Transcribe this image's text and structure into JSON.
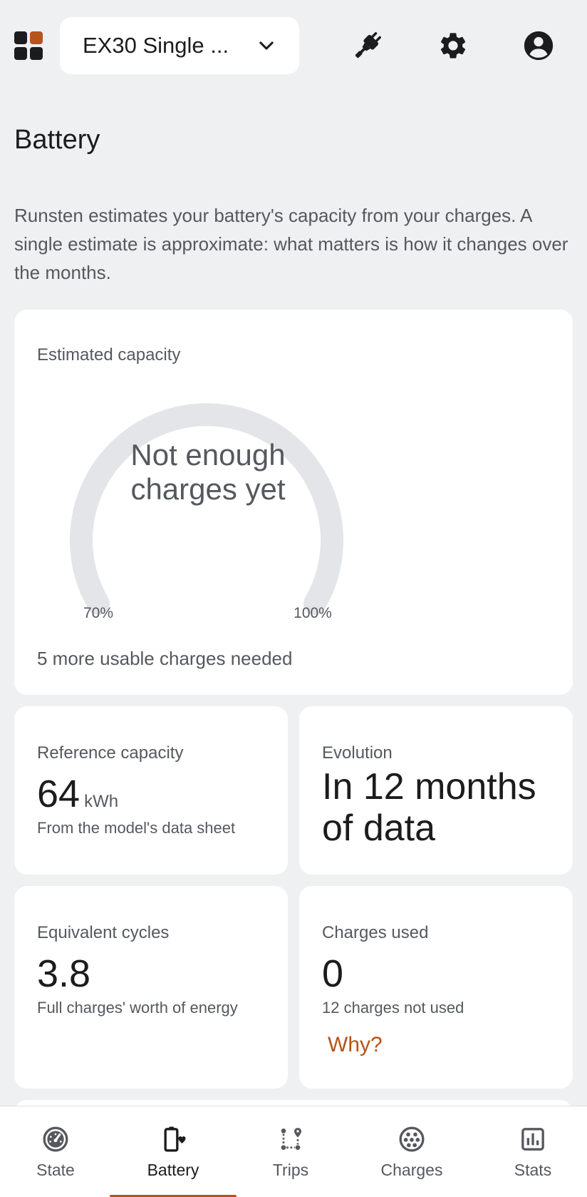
{
  "header": {
    "apps_icon": "apps-grid-icon",
    "vehicle_name": "EX30 Single ...",
    "icons": [
      "plug-icon",
      "gear-icon",
      "account-circle-icon"
    ],
    "accent_color": "#b8531a"
  },
  "page": {
    "title": "Battery",
    "intro": "Runsten estimates your battery's capacity from your charges. A single estimate is approximate: what matters is how it changes over the months."
  },
  "capacity_card": {
    "label": "Estimated capacity",
    "gauge_text_line1": "Not enough",
    "gauge_text_line2": "charges yet",
    "gauge_min": "70%",
    "gauge_max": "100%",
    "needed": "5 more usable charges needed"
  },
  "reference_card": {
    "label": "Reference capacity",
    "value": "64",
    "unit": "kWh",
    "sub": "From the model's data sheet"
  },
  "evolution_card": {
    "label": "Evolution",
    "value": "In 12 months of data"
  },
  "cycles_card": {
    "label": "Equivalent cycles",
    "value": "3.8",
    "sub": "Full charges' worth of energy"
  },
  "charges_used_card": {
    "label": "Charges used",
    "value": "0",
    "sub": "12 charges not used",
    "link": "Why?"
  },
  "bottom_nav": {
    "items": [
      {
        "label": "State",
        "icon": "gauge-icon",
        "active": false
      },
      {
        "label": "Battery",
        "icon": "battery-heart-icon",
        "active": true
      },
      {
        "label": "Trips",
        "icon": "route-icon",
        "active": false
      },
      {
        "label": "Charges",
        "icon": "charging-connector-icon",
        "active": false
      },
      {
        "label": "Stats",
        "icon": "bar-chart-icon",
        "active": false
      }
    ]
  }
}
